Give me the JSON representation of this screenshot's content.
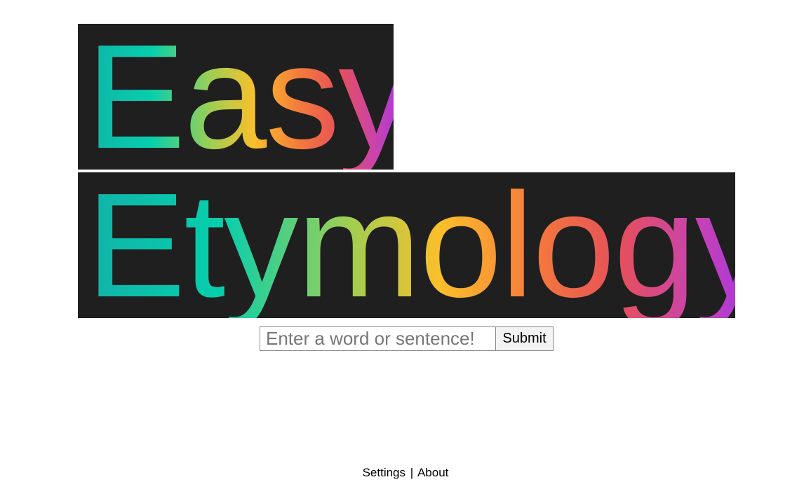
{
  "logo": {
    "line1": "Easy",
    "line2": "Etymology",
    "gradient_colors": [
      "#11b3a8",
      "#06cfad",
      "#9ccf54",
      "#fbbf2a",
      "#f4793c",
      "#e6505a",
      "#c642b4",
      "#9b32f0"
    ],
    "background_color": "#1f1f1f"
  },
  "search": {
    "placeholder": "Enter a word or sentence!",
    "value": "",
    "submit_label": "Submit"
  },
  "footer": {
    "settings_label": "Settings",
    "separator": "|",
    "about_label": "About"
  }
}
